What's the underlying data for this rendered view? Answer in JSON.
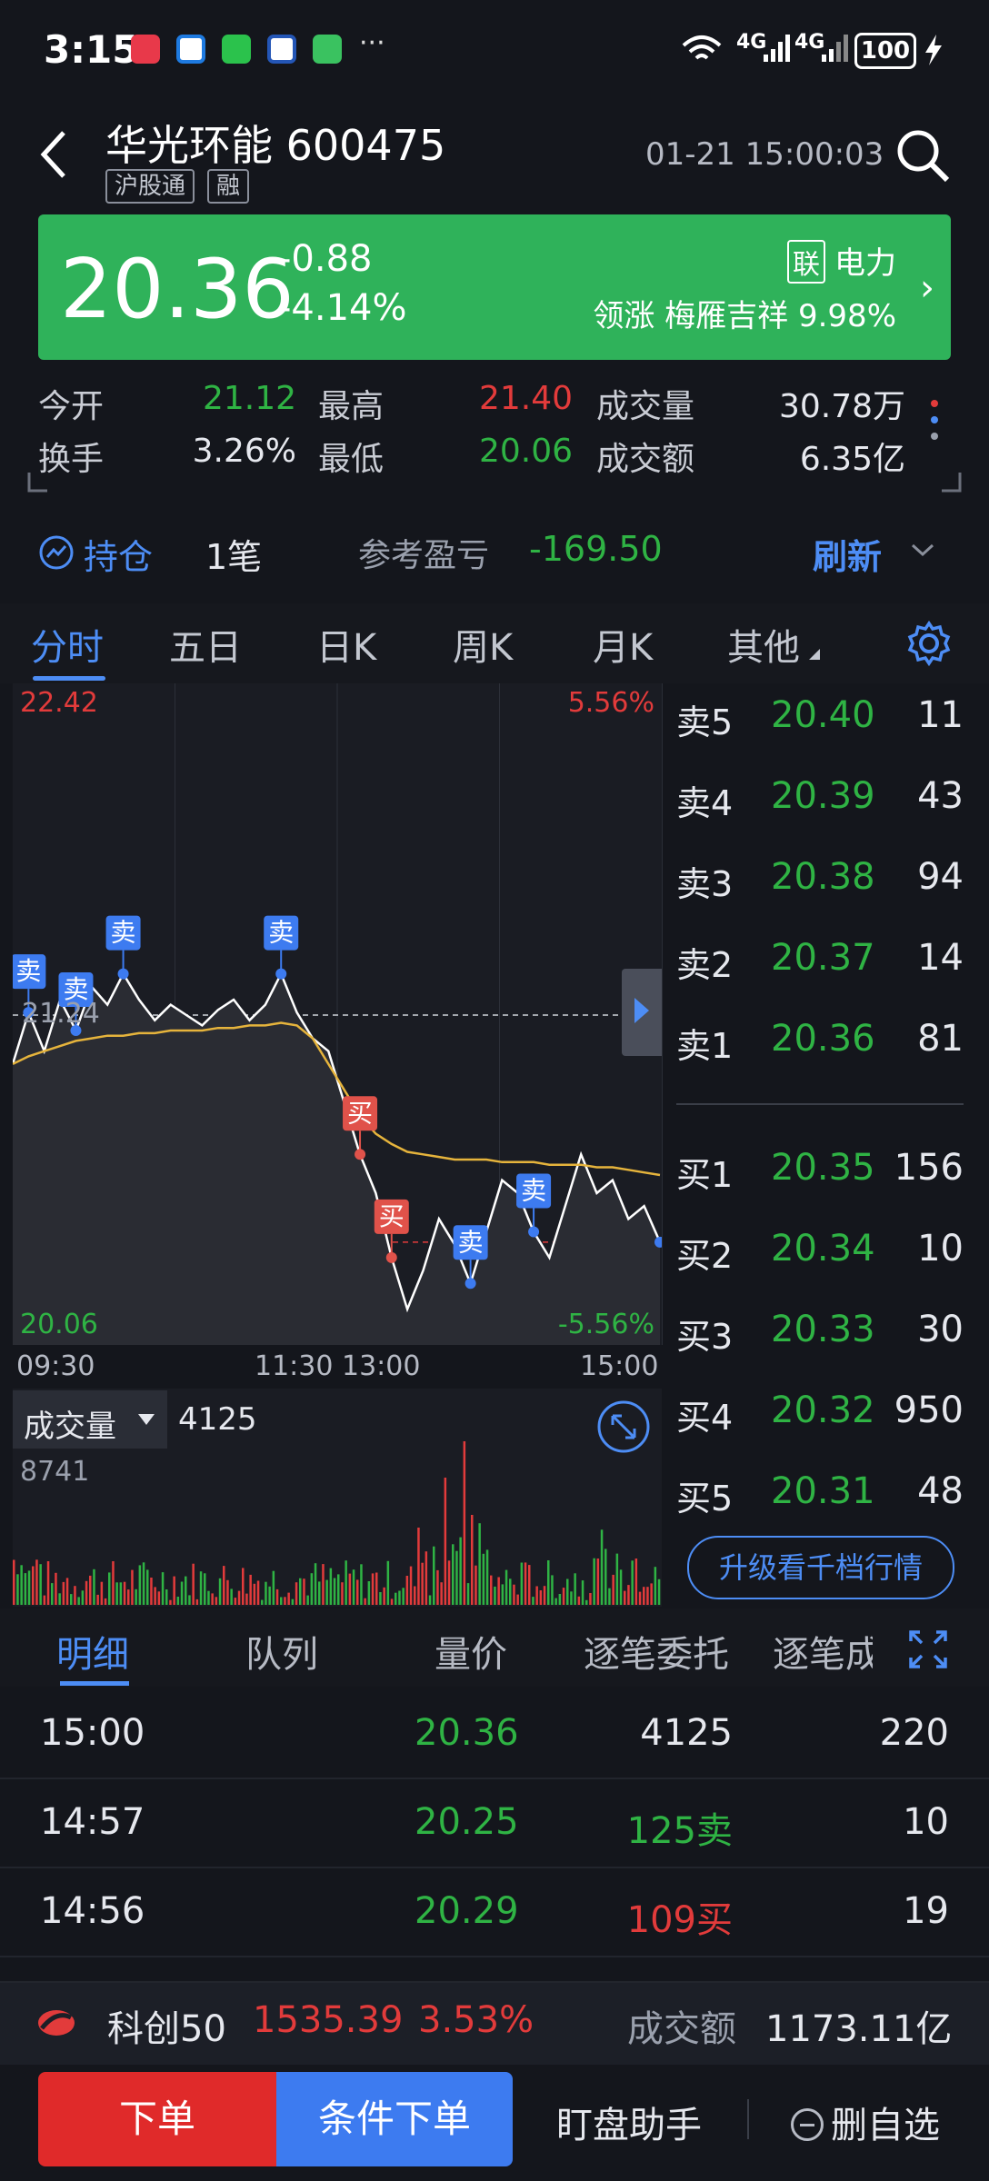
{
  "status_bar": {
    "time": "3:15",
    "more": "···",
    "net1": "4G",
    "net2": "4G",
    "battery": "100"
  },
  "header": {
    "title": "华光环能 600475",
    "tags": [
      "沪股通",
      "融"
    ],
    "timestamp": "01-21 15:00:03"
  },
  "quote": {
    "price": "20.36",
    "change": "-0.88",
    "change_pct": "-4.14%",
    "sector_badge": "联",
    "sector": "电力",
    "leader": "领涨  梅雁吉祥  9.98%"
  },
  "stats": {
    "open_label": "今开",
    "open": "21.12",
    "high_label": "最高",
    "high": "21.40",
    "volume_label": "成交量",
    "volume": "30.78万",
    "turnover_label": "换手",
    "turnover": "3.26%",
    "low_label": "最低",
    "low": "20.06",
    "amount_label": "成交额",
    "amount": "6.35亿"
  },
  "position": {
    "label": "持仓",
    "count": "1笔",
    "ref_label": "参考盈亏",
    "pnl": "-169.50",
    "refresh": "刷新"
  },
  "chart_tabs": [
    "分时",
    "五日",
    "日K",
    "周K",
    "月K",
    "其他"
  ],
  "chart": {
    "top_price": "22.42",
    "top_pct": "5.56%",
    "bottom_price": "20.06",
    "bottom_pct": "-5.56%",
    "ref_line_label": "21.24",
    "time_labels": [
      "09:30",
      "11:30 13:00",
      "15:00"
    ],
    "sell_marker": "卖",
    "buy_marker": "买"
  },
  "chart_data": {
    "type": "line",
    "title": "",
    "xlabel": "",
    "ylabel": "",
    "ylim": [
      20.06,
      22.42
    ],
    "x_ticks": [
      "09:30",
      "11:30 13:00",
      "15:00"
    ],
    "reference_price": 21.24,
    "series": [
      {
        "values": [
          21.05,
          21.25,
          21.1,
          21.3,
          21.18,
          21.35,
          21.28,
          21.4,
          21.3,
          21.22,
          21.28,
          21.24,
          21.2,
          21.26,
          21.3,
          21.22,
          21.28,
          21.4,
          21.25,
          21.15,
          21.1,
          20.9,
          20.7,
          20.55,
          20.3,
          20.1,
          20.25,
          20.45,
          20.35,
          20.2,
          20.4,
          20.6,
          20.55,
          20.4,
          20.3,
          20.5,
          20.7,
          20.55,
          20.6,
          20.45,
          20.5,
          20.36
        ]
      },
      {
        "values": [
          21.05,
          21.08,
          21.1,
          21.12,
          21.14,
          21.15,
          21.16,
          21.16,
          21.17,
          21.17,
          21.18,
          21.18,
          21.18,
          21.19,
          21.19,
          21.2,
          21.2,
          21.21,
          21.2,
          21.15,
          21.05,
          20.95,
          20.85,
          20.78,
          20.74,
          20.71,
          20.7,
          20.69,
          20.68,
          20.68,
          20.68,
          20.67,
          20.67,
          20.67,
          20.66,
          20.66,
          20.66,
          20.65,
          20.65,
          20.64,
          20.63,
          20.62
        ]
      }
    ],
    "volume_max": 8741,
    "volume_last": 4125
  },
  "order_book": {
    "asks": [
      {
        "label": "卖5",
        "price": "20.40",
        "vol": "11"
      },
      {
        "label": "卖4",
        "price": "20.39",
        "vol": "43"
      },
      {
        "label": "卖3",
        "price": "20.38",
        "vol": "94"
      },
      {
        "label": "卖2",
        "price": "20.37",
        "vol": "14"
      },
      {
        "label": "卖1",
        "price": "20.36",
        "vol": "81"
      }
    ],
    "bids": [
      {
        "label": "买1",
        "price": "20.35",
        "vol": "156"
      },
      {
        "label": "买2",
        "price": "20.34",
        "vol": "10"
      },
      {
        "label": "买3",
        "price": "20.33",
        "vol": "30"
      },
      {
        "label": "买4",
        "price": "20.32",
        "vol": "950"
      },
      {
        "label": "买5",
        "price": "20.31",
        "vol": "48"
      }
    ],
    "upgrade": "升级看千档行情"
  },
  "volume_panel": {
    "label": "成交量",
    "value": "4125",
    "max": "8741"
  },
  "detail_tabs": [
    "明细",
    "队列",
    "量价",
    "逐笔委托",
    "逐笔成交"
  ],
  "trades": [
    {
      "time": "15:00",
      "price": "20.36",
      "vol": "4125",
      "num": "220"
    },
    {
      "time": "14:57",
      "price": "20.25",
      "vol": "125卖",
      "num": "10"
    },
    {
      "time": "14:56",
      "price": "20.29",
      "vol": "109买",
      "num": "19"
    }
  ],
  "index_bar": {
    "name": "科创50",
    "value": "1535.39",
    "pct": "3.53%",
    "amount_label": "成交额",
    "amount": "1173.11亿"
  },
  "bottom": {
    "order": "下单",
    "condition": "条件下单",
    "assistant": "盯盘助手",
    "remove": "删自选"
  },
  "colors": {
    "up": "#e23b3b",
    "down": "#2fb344",
    "accent": "#4d8df5",
    "banner": "#2fb25a"
  }
}
